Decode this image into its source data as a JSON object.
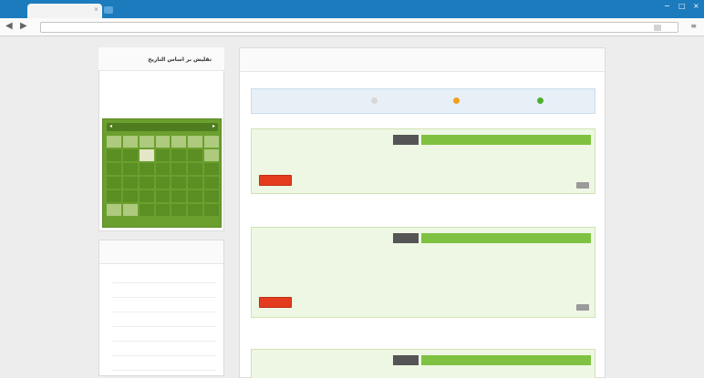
{
  "browser": {
    "tab_title": "",
    "url": "",
    "win_minimize": "−",
    "win_maximize": "□",
    "win_close": "×",
    "back": "◀",
    "forward": "▶",
    "menu_glyph": "≡",
    "tab_close": "×"
  },
  "sidebar": {
    "calendar_title": "تقليش بر اساس التاريخ",
    "calendar_month": "",
    "list_title": "",
    "items": [
      "",
      "",
      "",
      "",
      "",
      "",
      "",
      "",
      ""
    ]
  },
  "main": {
    "title": "",
    "legend": [
      {
        "label": "",
        "color": "#4fb02f"
      },
      {
        "label": "",
        "color": "#f0a21a"
      },
      {
        "label": "",
        "color": "#e0e0e0"
      }
    ],
    "posts": [
      {
        "tag": "",
        "title": "",
        "body": "",
        "button": ""
      },
      {
        "tag": "",
        "title": "",
        "body": "",
        "button": ""
      },
      {
        "tag": "",
        "title": "",
        "body": "",
        "button": ""
      }
    ],
    "note_1": "",
    "note_2": ""
  },
  "colors": {
    "chrome_blue": "#1b7bbd",
    "calendar_green": "#6b9f2e",
    "post_green": "#7fc242",
    "button_red": "#e33b1e"
  }
}
